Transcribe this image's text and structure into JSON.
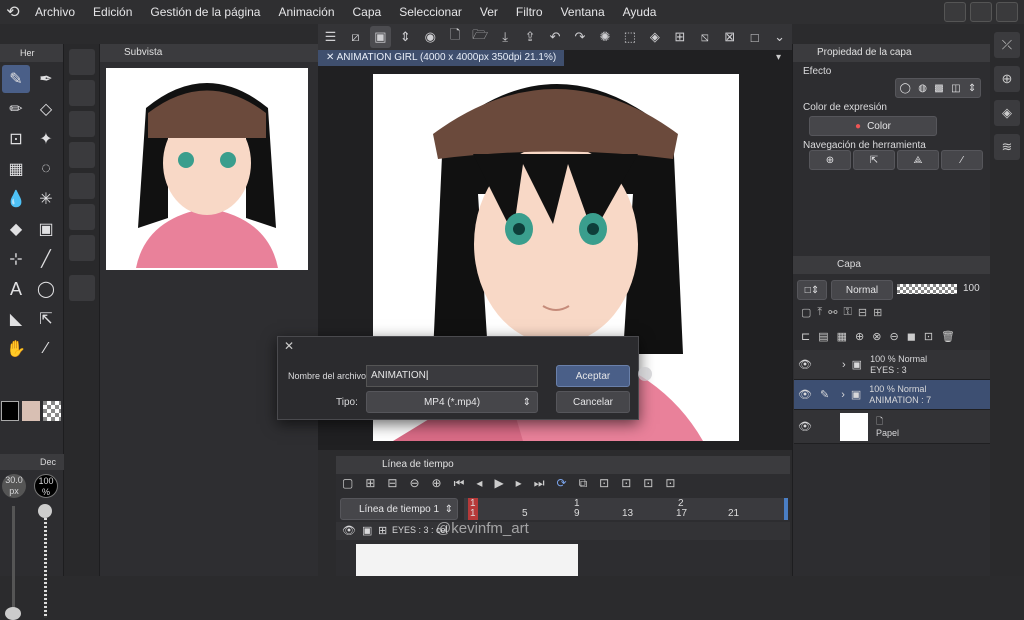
{
  "menu": {
    "items": [
      "Archivo",
      "Edición",
      "Gestión de la página",
      "Animación",
      "Capa",
      "Seleccionar",
      "Ver",
      "Filtro",
      "Ventana",
      "Ayuda"
    ]
  },
  "left_panel": {
    "tab_label": "Her",
    "tool_icons": [
      "pen-icon",
      "brush-icon",
      "pencil-icon",
      "eraser-icon",
      "fill-icon",
      "sparkle-icon",
      "grid-icon",
      "lasso-icon",
      "drops-icon",
      "magic-wand-icon",
      "bucket-icon",
      "gradient-icon",
      "transform-icon",
      "line-icon",
      "text-icon",
      "balloon-icon",
      "polygon-icon",
      "cursor-icon",
      "hand-icon",
      "eyedropper-icon"
    ],
    "bottom_tab": "Dec",
    "size_value": "30.0",
    "size_unit": "px",
    "opacity_value": "100",
    "opacity_unit": "%"
  },
  "subvista": {
    "title": "Subvista"
  },
  "document": {
    "tab_title": "ANIMATION GIRL (4000 x 4000px 350dpi 21.1%)"
  },
  "layer_property": {
    "title": "Propiedad de la capa",
    "effect_label": "Efecto",
    "expression_color_label": "Color de expresión",
    "color_value": "Color",
    "tool_nav_label": "Navegación de herramienta"
  },
  "layers_panel": {
    "title": "Capa",
    "blend_mode": "Normal",
    "opacity": "100",
    "layers": [
      {
        "pct": "100 %",
        "mode": "Normal",
        "name": "EYES : 3",
        "selected": false
      },
      {
        "pct": "100 %",
        "mode": "Normal",
        "name": "ANIMATION : 7",
        "selected": true
      },
      {
        "pct": "",
        "mode": "",
        "name": "Papel",
        "selected": false
      }
    ]
  },
  "dialog": {
    "filename_label": "Nombre del archivo:",
    "filename_value": "ANIMATION",
    "type_label": "Tipo:",
    "type_value": "MP4 (*.mp4)",
    "accept_label": "Aceptar",
    "cancel_label": "Cancelar"
  },
  "timeline": {
    "title": "Línea de tiempo",
    "name": "Línea de tiempo 1",
    "track_name": "EYES : 3 : cel",
    "frame_numbers": [
      "1",
      "5",
      "9",
      "13",
      "17",
      "21"
    ],
    "top_numbers": [
      "1",
      "1",
      "2"
    ],
    "watermark": "@kevinfm_art"
  },
  "colors": {
    "accent": "#4a5f88",
    "selection": "#3d4f72",
    "button": "#46464a",
    "hair": "#6b4a3c",
    "skin": "#f8d8c6",
    "shirt": "#e9819a"
  }
}
